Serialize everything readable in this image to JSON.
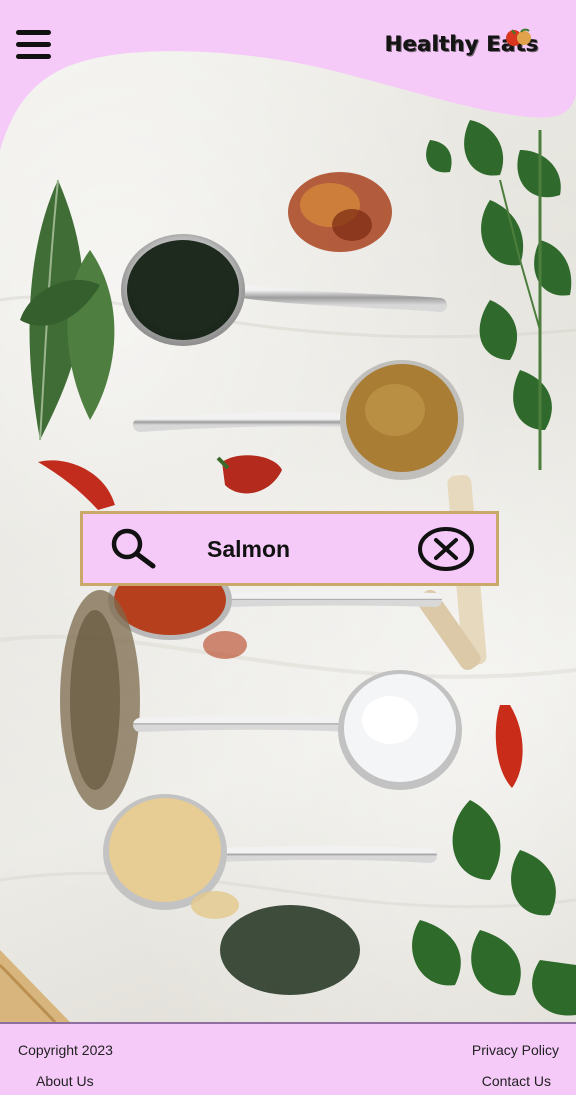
{
  "header": {
    "menu_icon": "hamburger-menu-icon",
    "brand_name": "Healthy Eats",
    "brand_logo_icon": "vegetable-logo-icon",
    "background_color": "#f5caf8"
  },
  "hero": {
    "background_image": "spices-on-spoons-photo"
  },
  "search": {
    "value": "Salmon",
    "search_icon": "search-icon",
    "clear_icon": "clear-circle-x-icon",
    "background_color": "#f5caf8",
    "border_color": "#c9a86a"
  },
  "footer": {
    "copyright": "Copyright 2023",
    "privacy_policy": "Privacy Policy",
    "about_us": "About Us",
    "contact_us": "Contact Us",
    "background_color": "#f5caf8"
  }
}
